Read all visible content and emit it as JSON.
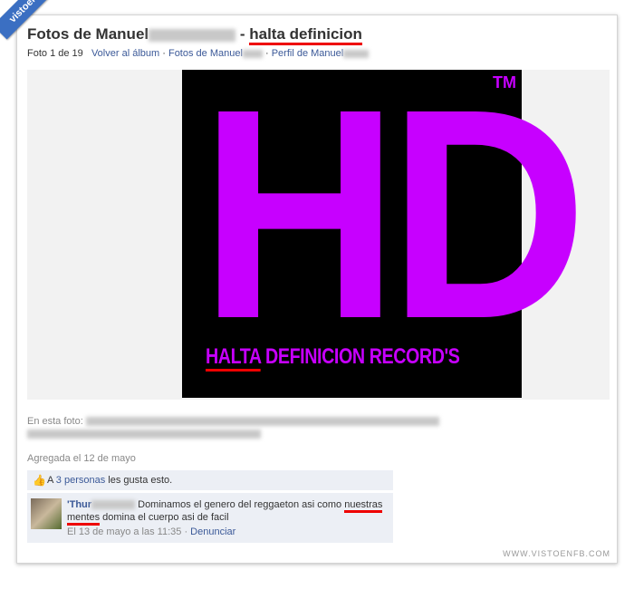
{
  "ribbon": {
    "text": "vistoenfb.com"
  },
  "header": {
    "title_prefix": "Fotos de Manuel",
    "title_separator": " - ",
    "title_album": "halta definicion"
  },
  "subnav": {
    "photo_count": "Foto 1 de 19",
    "back_to_album": "Volver al álbum",
    "photos_of": "Fotos de Manuel",
    "profile_of": "Perfil de Manuel",
    "separator": "·"
  },
  "poster": {
    "tm": "TM",
    "big_text": "HD",
    "brand_underlined": "HALTA",
    "brand_rest": " DEFINICION RECORD'S"
  },
  "tagged": {
    "label": "En esta foto:"
  },
  "added": {
    "text": "Agregada el 12 de mayo"
  },
  "likes": {
    "prefix": "A ",
    "people_link": "3 personas",
    "suffix": " les gusta esto."
  },
  "comment": {
    "author": "'Thur",
    "text_before": " Dominamos el genero del reggaeton asi como ",
    "text_underlined_1": "nuestras",
    "text_space": " ",
    "text_underlined_2": "mentes",
    "text_after": " domina el cuerpo asi de facil",
    "date": "El 13 de mayo a las 11:35",
    "meta_sep": " · ",
    "report": "Denunciar"
  },
  "watermark": {
    "text": "WWW.VISTOENFB.COM"
  },
  "colors": {
    "fb_link": "#3b5998",
    "accent_purple": "#c700ff",
    "annotation_red": "#e00000"
  },
  "icons": {
    "like": "thumbs-up-icon"
  }
}
